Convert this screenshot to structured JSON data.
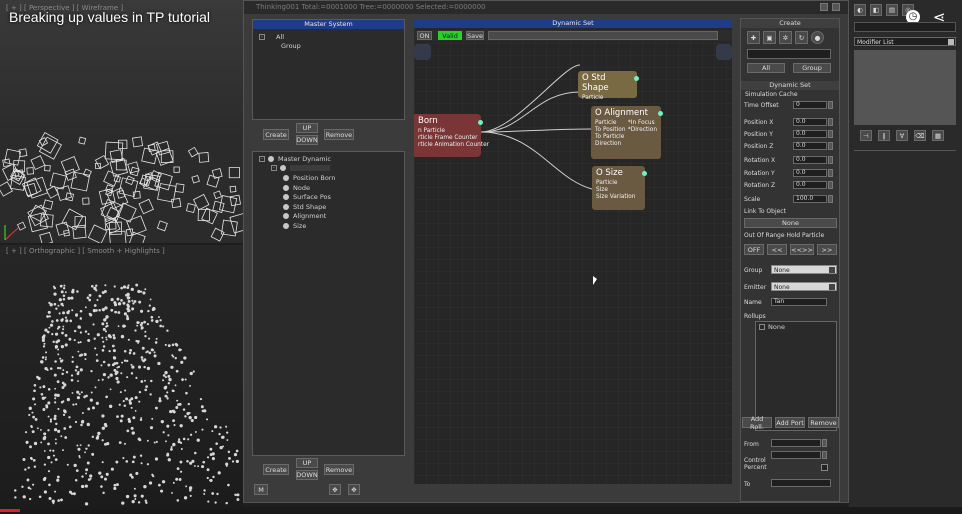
{
  "video": {
    "title": "Breaking up values in TP tutorial"
  },
  "viewports": {
    "top_label": "[ + ] [ Perspective ] [ Wireframe ]",
    "bottom_label": "[ + ] [ Orthographic ] [ Smooth + Highlights ]"
  },
  "window": {
    "title": "Thinking001  Total:=0001000  Tree:=0000000  Selected:=0000000",
    "master_system": {
      "title": "Master System",
      "items": [
        "All",
        "Group"
      ],
      "buttons": {
        "create": "Create",
        "up": "UP",
        "down": "DOWN",
        "remove": "Remove"
      }
    },
    "master_dynamic": {
      "root": "Master Dynamic",
      "items": [
        "Position Born",
        "Node",
        "Surface Pos",
        "Std Shape",
        "Alignment",
        "Size"
      ],
      "buttons": {
        "create": "Create",
        "up": "UP",
        "down": "DOWN",
        "remove": "Remove",
        "m": "M"
      }
    }
  },
  "graph": {
    "title": "Dynamic Set",
    "toolbar": {
      "on": "ON",
      "valid": "Valid",
      "save": "Save"
    },
    "nodes": {
      "born": {
        "title": "Born",
        "lines": [
          "n Particle",
          "rticle Frame Counter",
          "rticle Animation Counter"
        ]
      },
      "std_shape": {
        "title": "O Std Shape",
        "lines": [
          "Particle"
        ]
      },
      "alignment": {
        "title": "O Alignment",
        "left": [
          "Particle",
          "To Position",
          "To Particle",
          "Direction"
        ],
        "right": [
          "*In Focus",
          "*Direction"
        ]
      },
      "size": {
        "title": "O Size",
        "lines": [
          "Particle",
          "Size",
          "Size Variation"
        ]
      }
    }
  },
  "right_panel": {
    "create_head": "Create",
    "create_tabs": {
      "all": "All",
      "group": "Group"
    },
    "dynamic_set_head": "Dynamic Set",
    "simulation_cache": "Simulation Cache",
    "fields": [
      {
        "label": "Time Offset",
        "value": "0"
      },
      {
        "label": "Position X",
        "value": "0.0"
      },
      {
        "label": "Position Y",
        "value": "0.0"
      },
      {
        "label": "Position Z",
        "value": "0.0"
      },
      {
        "label": "Rotation X",
        "value": "0.0"
      },
      {
        "label": "Rotation Y",
        "value": "0.0"
      },
      {
        "label": "Rotation Z",
        "value": "0.0"
      },
      {
        "label": "Scale",
        "value": "100.0"
      }
    ],
    "link_to_object": "Link To Object",
    "link_none": "None",
    "out_of_range": "Out Of Range Hold Particle",
    "nav": [
      "OFF",
      "<<",
      "<<>>",
      ">>"
    ],
    "group_label": "Group",
    "group_value": "None",
    "emitter_label": "Emitter",
    "emitter_value": "None",
    "name_label": "Name",
    "name_value": "Tan",
    "rollups_label": "Rollups",
    "rollups_item": "None",
    "add_roll": "Add Roll.",
    "add_port": "Add Port",
    "remove": "Remove",
    "from_label": "From",
    "control_label": "Control",
    "percent_label": "Percent",
    "to_label": "To"
  },
  "modifier": {
    "list_label": "Modifier List"
  },
  "colors": {
    "accent": "#1e3c8a",
    "valid": "#2bd12b",
    "born": "#7a3636",
    "std_shape": "#7a6a44",
    "alignment": "#6b5a42",
    "size": "#6b5a42",
    "port": "#6ef3c6"
  }
}
